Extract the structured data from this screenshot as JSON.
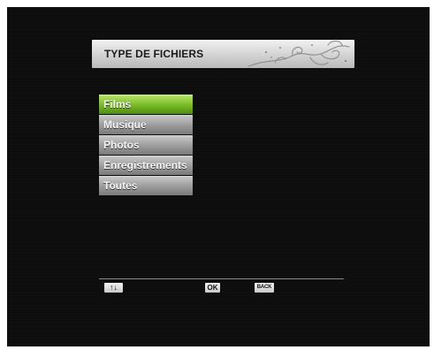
{
  "header": {
    "title": "TYPE DE FICHIERS"
  },
  "menu": {
    "items": [
      {
        "label": "Films",
        "selected": true
      },
      {
        "label": "Musique",
        "selected": false
      },
      {
        "label": "Photos",
        "selected": false
      },
      {
        "label": "Enregistrements",
        "selected": false
      },
      {
        "label": "Toutes",
        "selected": false
      }
    ]
  },
  "footer": {
    "nav_key": "↑↓",
    "ok_key": "OK",
    "back_key": "BACK"
  },
  "colors": {
    "background": "#0d0d0d",
    "selected_accent": "#7fc12a",
    "item_gray": "#9d9d9d"
  },
  "icons": {
    "title_decoration": "swirl-ornament",
    "nav_key": "up-down-arrows"
  }
}
